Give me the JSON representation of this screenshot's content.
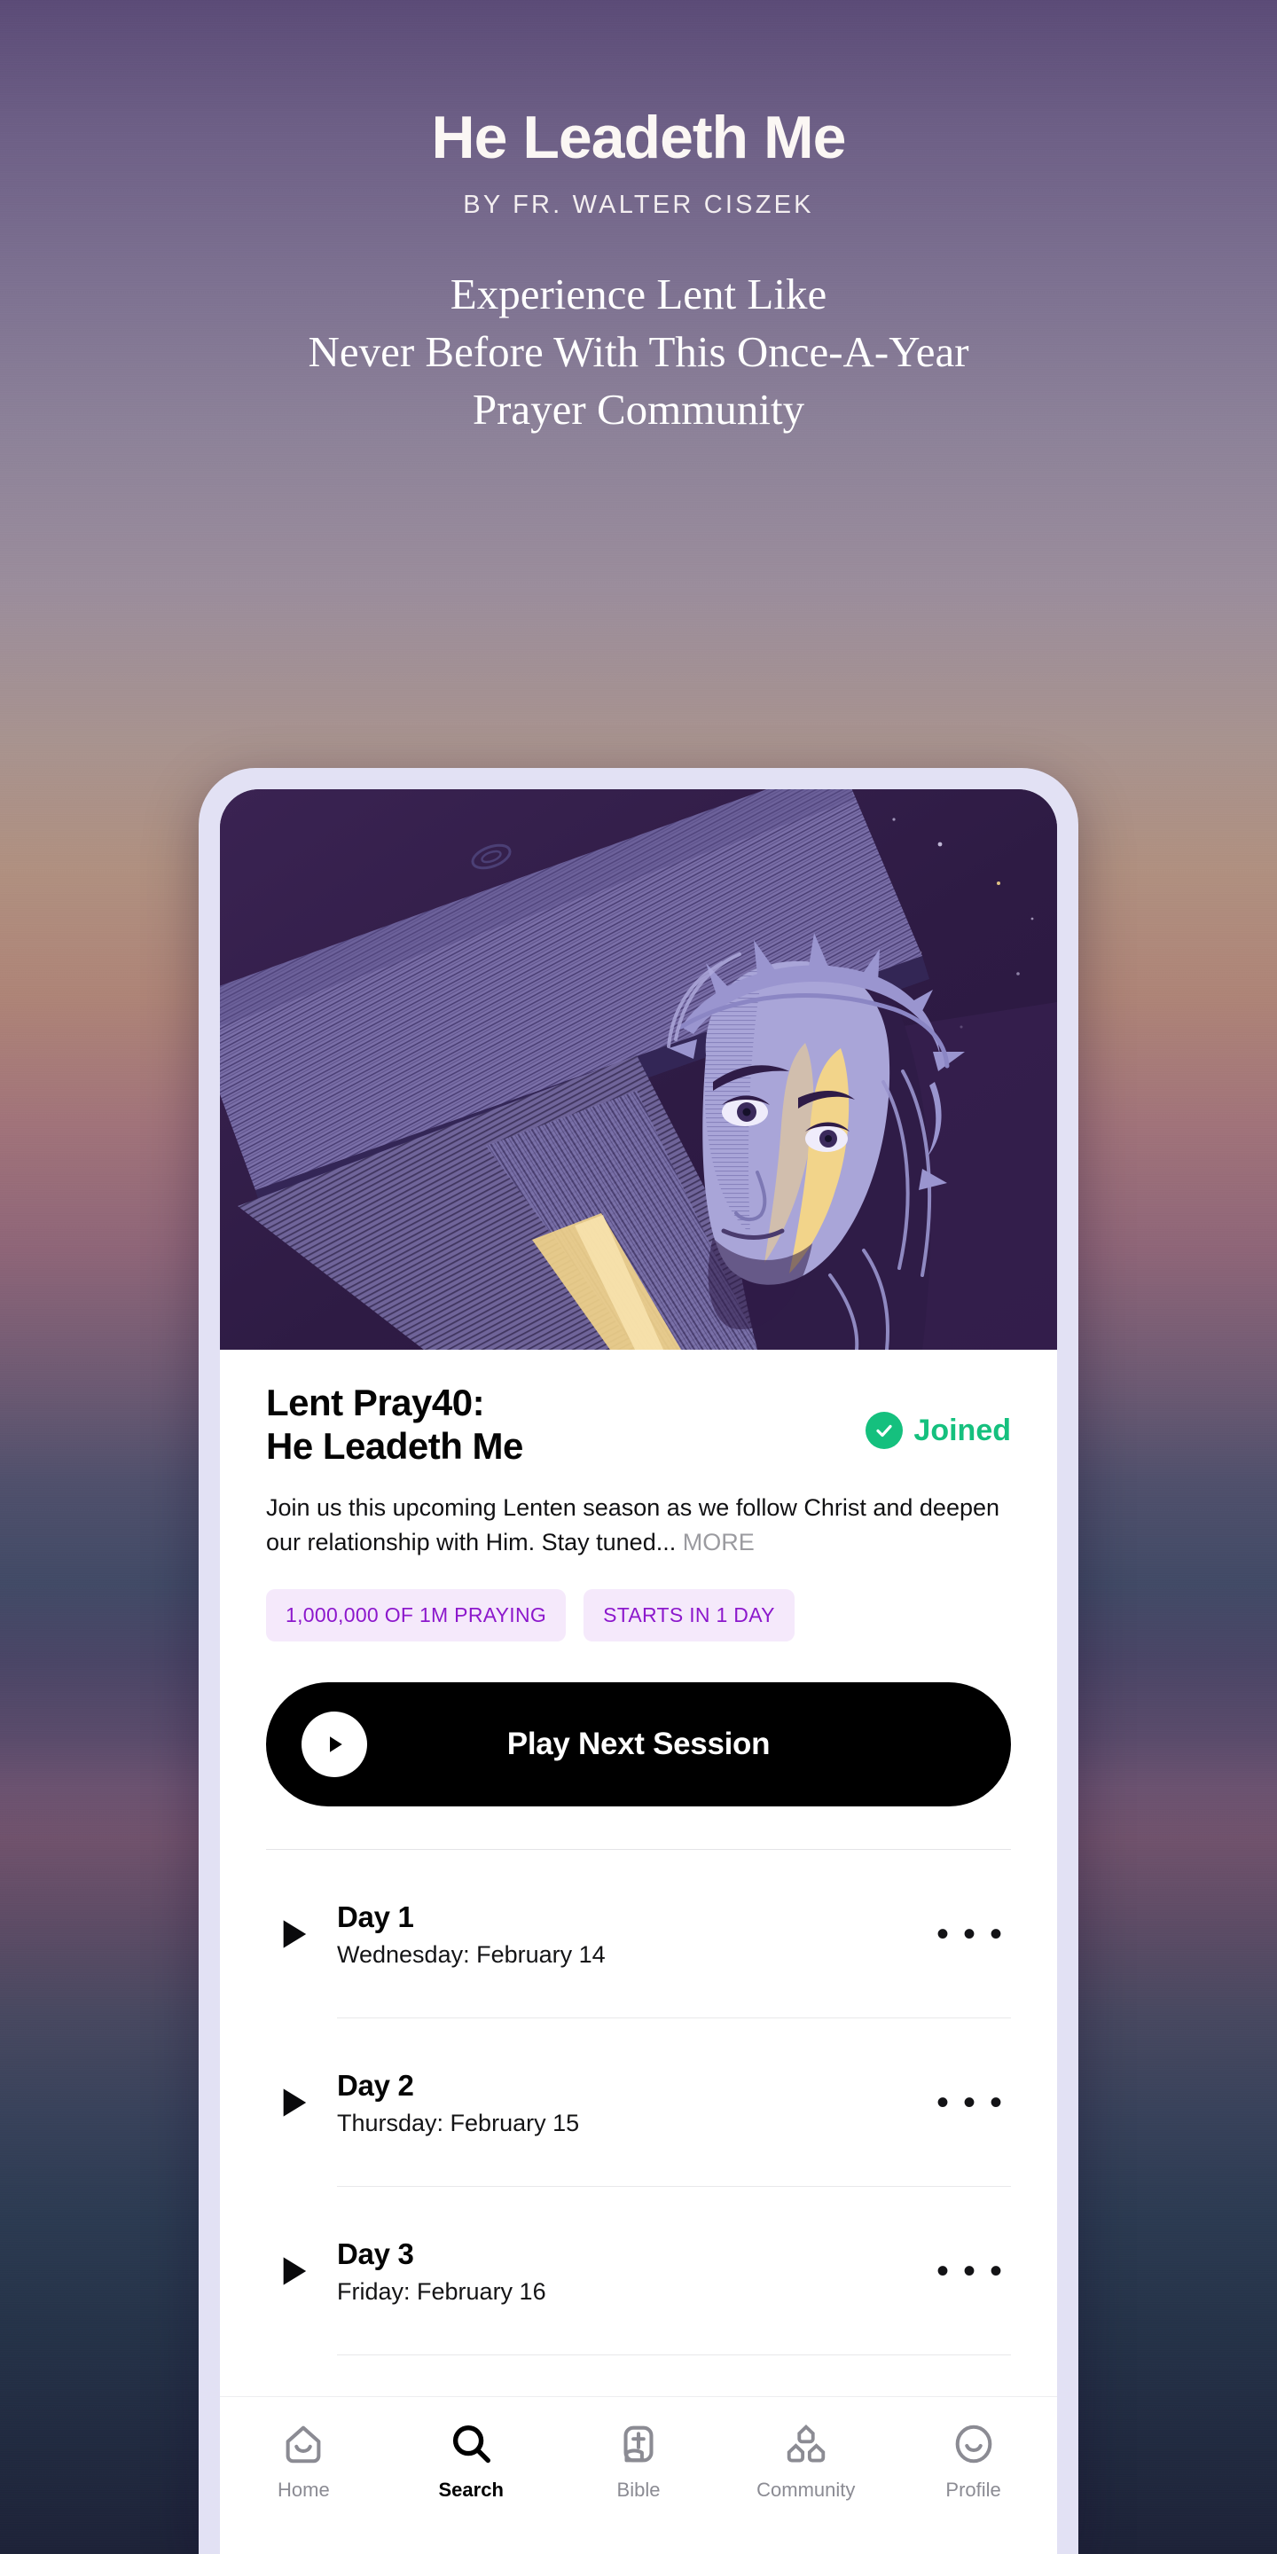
{
  "header": {
    "title": "He Leadeth Me",
    "byline": "BY FR. WALTER CISZEK",
    "tagline_line1": "Experience Lent Like",
    "tagline_line2": "Never Before With This Once-A-Year",
    "tagline_line3": "Prayer Community"
  },
  "hero": {
    "alt": "Illustration of Jesus carrying the cross with crown of thorns",
    "colors": {
      "night": "#2d1a42",
      "wood_light": "#8b84bb",
      "wood_mid": "#6b5f94",
      "skin": "#a9a5d8",
      "gold": "#f2d48a"
    }
  },
  "card": {
    "title_line1": "Lent Pray40:",
    "title_line2": "He Leadeth Me",
    "joined_label": "Joined",
    "joined_color": "#15c07e",
    "description": "Join us this upcoming Lenten season as we follow Christ and deepen our relationship with Him. Stay tuned...",
    "more_label": " MORE",
    "tags": [
      "1,000,000 OF 1M PRAYING",
      "STARTS IN 1 DAY"
    ],
    "tag_bg": "#f5e9fb",
    "tag_color": "#8c18cc",
    "play_button_label": "Play Next Session"
  },
  "days": [
    {
      "name": "Day 1",
      "date": "Wednesday: February 14",
      "menu": "• • •"
    },
    {
      "name": "Day 2",
      "date": "Thursday: February 15",
      "menu": "• • •"
    },
    {
      "name": "Day 3",
      "date": "Friday: February 16",
      "menu": "• • •"
    }
  ],
  "bottom_nav": {
    "items": [
      {
        "label": "Home",
        "icon": "home-icon",
        "active": false
      },
      {
        "label": "Search",
        "icon": "search-icon",
        "active": true
      },
      {
        "label": "Bible",
        "icon": "bible-icon",
        "active": false
      },
      {
        "label": "Community",
        "icon": "community-icon",
        "active": false
      },
      {
        "label": "Profile",
        "icon": "profile-icon",
        "active": false
      }
    ]
  }
}
